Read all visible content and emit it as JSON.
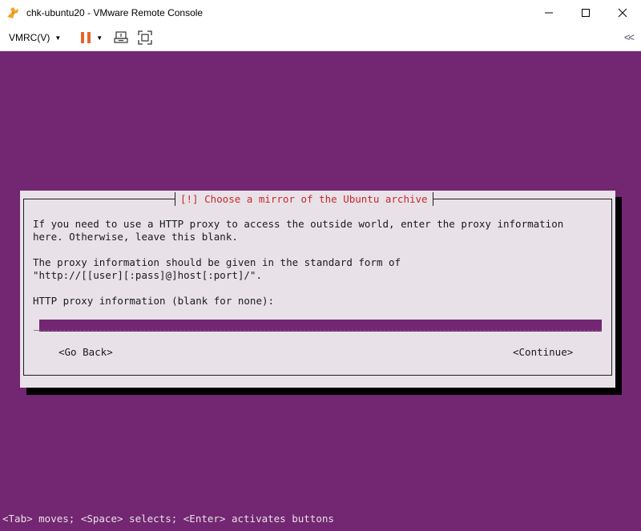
{
  "window": {
    "title": "chk-ubuntu20 - VMware Remote Console",
    "controls": [
      "minimize-icon",
      "maximize-icon",
      "close-icon"
    ]
  },
  "toolbar": {
    "vmrc_menu_label": "VMRC(V)",
    "pause_color": "#e8632b",
    "collapse_label": "<<"
  },
  "console": {
    "background": "#732671",
    "dialog": {
      "title": "[!] Choose a mirror of the Ubuntu archive",
      "line1": "If you need to use a HTTP proxy to access the outside world, enter the proxy information",
      "line2": "here. Otherwise, leave this blank.",
      "line3": "The proxy information should be given in the standard form of",
      "line4": "\"http://[[user][:pass]@]host[:port]/\".",
      "field_label": "HTTP proxy information (blank for none):",
      "field_value": "",
      "cursor": "_",
      "back_button": "<Go Back>",
      "continue_button": "<Continue>"
    },
    "status_line": "<Tab> moves; <Space> selects; <Enter> activates buttons"
  }
}
